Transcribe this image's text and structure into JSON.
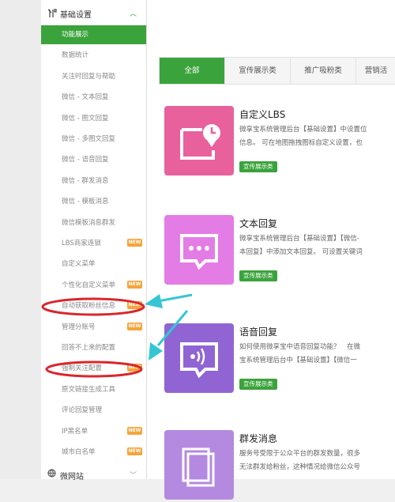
{
  "sidebar": {
    "header": {
      "label": "基础设置",
      "icon": "wrench-icon"
    },
    "items": [
      {
        "label": "功能展示",
        "active": true,
        "badge": ""
      },
      {
        "label": "数据统计",
        "badge": ""
      },
      {
        "label": "关注时回复与帮助",
        "badge": ""
      },
      {
        "label": "微信 - 文本回复",
        "badge": ""
      },
      {
        "label": "微信 - 图文回复",
        "badge": ""
      },
      {
        "label": "微信 - 多图文回复",
        "badge": ""
      },
      {
        "label": "微信 - 语音回复",
        "badge": ""
      },
      {
        "label": "微信 - 群发消息",
        "badge": ""
      },
      {
        "label": "微信 - 模板消息",
        "badge": ""
      },
      {
        "label": "微信模板消息群发",
        "badge": ""
      },
      {
        "label": "LBS商家连锁",
        "badge": "NEW"
      },
      {
        "label": "自定义菜单",
        "badge": ""
      },
      {
        "label": "个性化自定义菜单",
        "badge": "NEW"
      },
      {
        "label": "自动获取粉丝信息",
        "badge": "NEW"
      },
      {
        "label": "管理分账号",
        "badge": "NEW"
      },
      {
        "label": "回答不上来的配置",
        "badge": ""
      },
      {
        "label": "强制关注配置",
        "badge": "NEW"
      },
      {
        "label": "原文链接生成工具",
        "badge": ""
      },
      {
        "label": "评论回复管理",
        "badge": ""
      },
      {
        "label": "IP黑名单",
        "badge": "NEW"
      },
      {
        "label": "城市白名单",
        "badge": "NEW"
      }
    ],
    "footer": {
      "label": "微网站",
      "icon": "globe-icon"
    }
  },
  "tabs": [
    "全部",
    "宣传展示类",
    "推广吸粉类",
    "营销活"
  ],
  "cards": [
    {
      "title": "自定义LBS",
      "desc1": "微享宝系统管理后台【基础设置】中设置位",
      "desc2": "信息。 可在地图拖拽图标自定义设置，也",
      "tag": "宣传展示类",
      "color": "#e8619d",
      "icon": "location-clock-icon"
    },
    {
      "title": "文本回复",
      "desc1": "微享宝系统管理后台【基础设置】【微信-",
      "desc2": "本回复】中添加文本回复。 可设置关键词",
      "tag": "宣传展示类",
      "color": "#e47ce6",
      "icon": "chat-bubble-icon"
    },
    {
      "title": "语音回复",
      "desc1": "如何使用微享宝中语音回复功能？　在微",
      "desc2": "宝系统管理后台中【基础设置】【微信一",
      "tag": "宣传展示类",
      "color": "#9065d3",
      "icon": "voice-bubble-icon"
    },
    {
      "title": "群发消息",
      "desc1": "服务号受限于公众平台的群发数量，很多",
      "desc2": "无法群发给粉丝，这种情况给微信公众号",
      "tag": "",
      "color": "#b48ae0",
      "icon": "stacked-pages-icon"
    }
  ],
  "colors": {
    "accent": "#3ba33b",
    "badge": "#f6a43b",
    "annotation": "#d9262c",
    "arrow": "#35c6d6"
  }
}
